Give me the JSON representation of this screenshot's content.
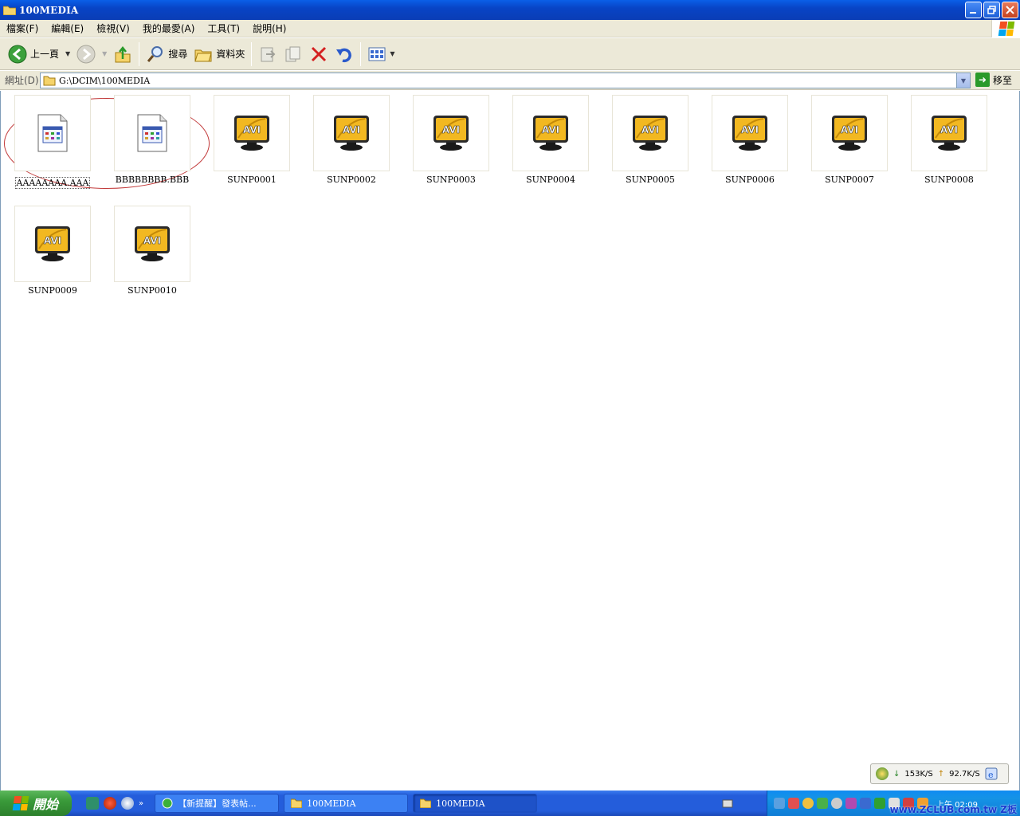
{
  "window": {
    "title": "100MEDIA"
  },
  "menu": [
    "檔案(F)",
    "編輯(E)",
    "檢視(V)",
    "我的最愛(A)",
    "工具(T)",
    "說明(H)"
  ],
  "toolbar": {
    "back_label": "上一頁",
    "search_label": "搜尋",
    "folders_label": "資料夾"
  },
  "address": {
    "label": "網址(D)",
    "path": "G:\\DCIM\\100MEDIA",
    "go_label": "移至"
  },
  "files": [
    {
      "name": "AAAAAAAA.AAA",
      "type": "doc",
      "selected": true
    },
    {
      "name": "BBBBBBBB.BBB",
      "type": "doc"
    },
    {
      "name": "SUNP0001",
      "type": "avi"
    },
    {
      "name": "SUNP0002",
      "type": "avi"
    },
    {
      "name": "SUNP0003",
      "type": "avi"
    },
    {
      "name": "SUNP0004",
      "type": "avi"
    },
    {
      "name": "SUNP0005",
      "type": "avi"
    },
    {
      "name": "SUNP0006",
      "type": "avi"
    },
    {
      "name": "SUNP0007",
      "type": "avi"
    },
    {
      "name": "SUNP0008",
      "type": "avi"
    },
    {
      "name": "SUNP0009",
      "type": "avi"
    },
    {
      "name": "SUNP0010",
      "type": "avi"
    }
  ],
  "avi_badge": "AVI",
  "netmeter": {
    "down": "153K/S",
    "up": "92.7K/S"
  },
  "taskbar": {
    "start_label": "開始",
    "tasks": [
      {
        "label": "【新提醒】發表帖...",
        "icon": "browser-icon"
      },
      {
        "label": "100MEDIA",
        "icon": "folder-icon"
      },
      {
        "label": "100MEDIA",
        "icon": "folder-icon",
        "active": true
      }
    ],
    "clock": "上午 02:09",
    "watermark": "www.ZCLUB.com.tw Z板"
  }
}
